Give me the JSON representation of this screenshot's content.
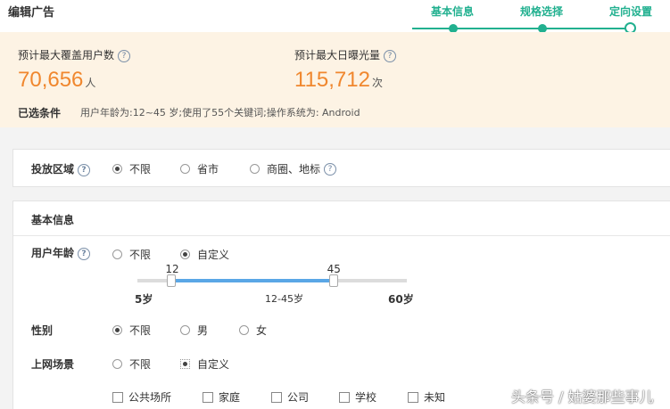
{
  "header": {
    "title": "编辑广告",
    "steps": [
      {
        "label": "基本信息"
      },
      {
        "label": "规格选择"
      },
      {
        "label": "定向设置"
      }
    ]
  },
  "summary": {
    "max_users_label": "预计最大覆盖用户数",
    "max_users_value": "70,656",
    "max_users_unit": "人",
    "max_impressions_label": "预计最大日曝光量",
    "max_impressions_value": "115,712",
    "max_impressions_unit": "次",
    "filters_label": "已选条件",
    "filters_text": "用户年龄为:12~45 岁;使用了55个关键词;操作系统为: Android"
  },
  "region": {
    "label": "投放区域",
    "options": [
      "不限",
      "省市",
      "商圈、地标"
    ],
    "selected": "不限"
  },
  "basic": {
    "title": "基本信息",
    "age": {
      "label": "用户年龄",
      "options": [
        "不限",
        "自定义"
      ],
      "selected": "自定义",
      "slider": {
        "min_label": "5岁",
        "max_label": "60岁",
        "min": 5,
        "max": 60,
        "low": 12,
        "high": 45,
        "low_label": "12",
        "high_label": "45",
        "range_label": "12-45岁"
      }
    },
    "gender": {
      "label": "性别",
      "options": [
        "不限",
        "男",
        "女"
      ],
      "selected": "不限"
    },
    "scene": {
      "label": "上网场景",
      "options": [
        "不限",
        "自定义"
      ],
      "selected": "自定义",
      "checkboxes": [
        "公共场所",
        "家庭",
        "公司",
        "学校",
        "未知"
      ]
    }
  },
  "icons": {
    "help": "?"
  },
  "colors": {
    "accent_green": "#21b08f",
    "metric_orange": "#f0872e",
    "summary_bg": "#fdf3e4",
    "slider_blue": "#5aa7e6"
  },
  "watermark": "头条号 / 姑婆那些事儿"
}
